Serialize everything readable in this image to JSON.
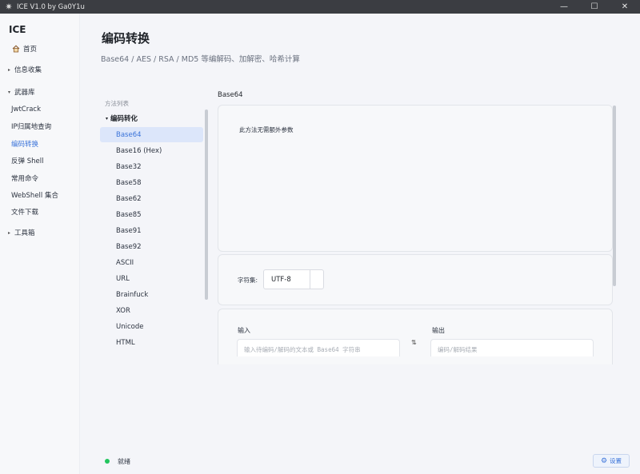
{
  "window": {
    "title": "ICE V1.0 by Ga0Y1u",
    "controls": [
      "—",
      "☐",
      "✕"
    ]
  },
  "sidebar": {
    "brand": "ICE",
    "home": "首页",
    "info_collect": "信息收集",
    "arsenal": "武器库",
    "items": [
      "JwtCrack",
      "IP归属地查询",
      "编码转换",
      "反弹 Shell",
      "常用命令",
      "WebShell 集合",
      "文件下载"
    ],
    "active_item": "编码转换",
    "toolbox": "工具箱"
  },
  "page": {
    "title": "编码转换",
    "subtitle": "Base64 / AES / RSA / MD5 等编解码、加解密、哈希计算"
  },
  "methods": {
    "header": "方法列表",
    "group": "编码转化",
    "items": [
      "Base64",
      "Base16 (Hex)",
      "Base32",
      "Base58",
      "Base62",
      "Base85",
      "Base91",
      "Base92",
      "ASCII",
      "URL",
      "Brainfuck",
      "XOR",
      "Unicode",
      "HTML"
    ],
    "selected": "Base64"
  },
  "panel": {
    "title": "Base64",
    "no_param_text": "此方法无需额外参数",
    "charset_label": "字符集:",
    "charset_value": "UTF-8",
    "input_label": "输入",
    "input_placeholder": "输入待编码/解码的文本或 Base64 字符串",
    "output_label": "输出",
    "output_placeholder": "编码/解码结果",
    "swap_symbol": "⇅"
  },
  "status": {
    "text": "就绪",
    "dot_color": "#22c55e",
    "settings_label": "设置"
  },
  "colors": {
    "accent": "#3a73d9",
    "titlebar": "#3b3d42"
  }
}
